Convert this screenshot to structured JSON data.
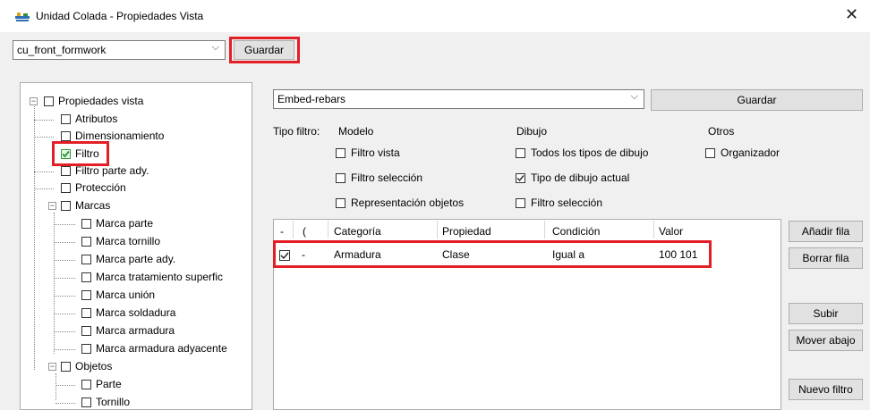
{
  "window": {
    "title": "Unidad Colada - Propiedades Vista"
  },
  "toolbar": {
    "view_name": "cu_front_formwork",
    "save_label": "Guardar"
  },
  "tree": {
    "root": "Propiedades vista",
    "items": [
      {
        "label": "Atributos"
      },
      {
        "label": "Dimensionamiento"
      },
      {
        "label": "Filtro",
        "checked": true
      },
      {
        "label": "Filtro parte ady."
      },
      {
        "label": "Protección"
      },
      {
        "label": "Marcas"
      },
      {
        "label": "Marca parte"
      },
      {
        "label": "Marca tornillo"
      },
      {
        "label": "Marca parte ady."
      },
      {
        "label": "Marca tratamiento superfic"
      },
      {
        "label": "Marca unión"
      },
      {
        "label": "Marca soldadura"
      },
      {
        "label": "Marca armadura"
      },
      {
        "label": "Marca armadura adyacente"
      },
      {
        "label": "Objetos"
      },
      {
        "label": "Parte"
      },
      {
        "label": "Tornillo"
      }
    ]
  },
  "filter": {
    "name": "Embed-rebars",
    "save_label": "Guardar",
    "type_label": "Tipo filtro:",
    "groups": {
      "modelo": "Modelo",
      "dibujo": "Dibujo",
      "otros": "Otros"
    },
    "options": {
      "filtro_vista": "Filtro vista",
      "filtro_seleccion": "Filtro selección",
      "representacion": "Representación objetos",
      "todos_tipos": "Todos los tipos de dibujo",
      "tipo_actual": "Tipo de dibujo actual",
      "dibujo_seleccion": "Filtro selección",
      "organizador": "Organizador"
    },
    "checked": {
      "tipo_actual": true
    }
  },
  "table": {
    "headers": [
      "-",
      "(",
      "Categoría",
      "Propiedad",
      "Condición",
      "Valor"
    ],
    "rows": [
      {
        "checked": true,
        "op": "-",
        "categoria": "Armadura",
        "propiedad": "Clase",
        "condicion": "Igual a",
        "valor": "100 101"
      }
    ]
  },
  "side_buttons": {
    "add": "Añadir fila",
    "delete": "Borrar fila",
    "up": "Subir",
    "down": "Mover abajo",
    "new": "Nuevo filtro"
  },
  "colors": {
    "highlight": "#e31e24",
    "check_green": "#2e9d3b"
  }
}
